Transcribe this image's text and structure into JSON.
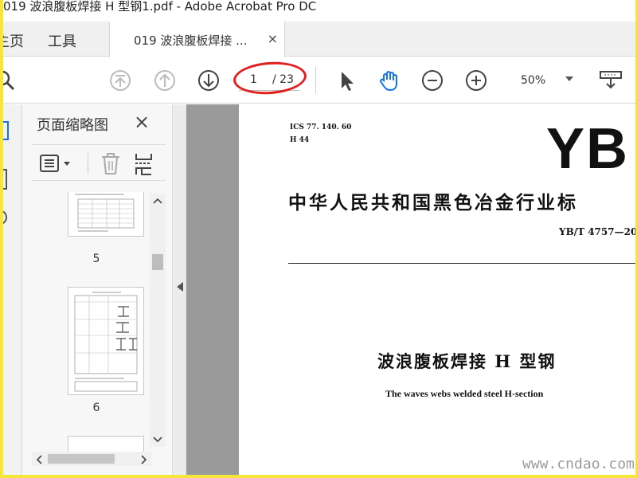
{
  "window": {
    "title": "019 波浪腹板焊接 H 型钢1.pdf - Adobe Acrobat Pro DC"
  },
  "tabbar": {
    "home_label": "主页",
    "tools_label": "工具",
    "document_tab_label": "019 波浪腹板焊接 ...",
    "close_glyph": "×"
  },
  "toolbar": {
    "current_page": "1",
    "total_pages": "/ 23",
    "zoom": "50%"
  },
  "thumbnails_panel": {
    "title": "页面缩略图",
    "close_glyph": "×",
    "pages": [
      {
        "label": "5"
      },
      {
        "label": "6"
      }
    ]
  },
  "document": {
    "ics_line": "ICS 77. 140. 60",
    "h_line": "H 44",
    "logo_text": "YB",
    "header_title": "中华人民共和国黑色冶金行业标",
    "standard_number": "YB/T 4757—20",
    "cn_title": "波浪腹板焊接 H 型钢",
    "en_title": "The waves webs welded steel H-section"
  },
  "watermark": {
    "text": "www.cndao.com"
  },
  "colors": {
    "accent_blue": "#1473e6",
    "annotation_red": "#e32020",
    "page_bg": "#9a9a9a",
    "outer_border": "#f5e63a"
  }
}
